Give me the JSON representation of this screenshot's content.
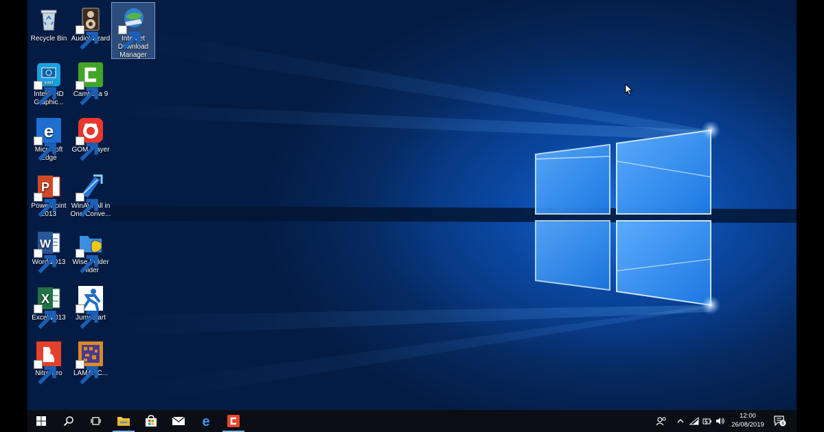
{
  "desktop": {
    "icons": [
      {
        "label": "Recycle Bin",
        "icon": "recycle-bin-icon"
      },
      {
        "label": "AudioWizard",
        "icon": "audiowizard-icon"
      },
      {
        "label": "Internet Download Manager",
        "icon": "internet-download-manager-icon"
      },
      {
        "label": "Intel® HD Graphic...",
        "icon": "intel-hd-graphics-icon"
      },
      {
        "label": "Camtasia 9",
        "icon": "camtasia-icon"
      },
      {
        "label": "Microsoft Edge",
        "icon": "edge-icon"
      },
      {
        "label": "GOM Player",
        "icon": "gom-player-icon"
      },
      {
        "label": "PowerPoint 2013",
        "icon": "powerpoint-icon"
      },
      {
        "label": "WinAVI All in One Conve...",
        "icon": "winavi-icon"
      },
      {
        "label": "Word 2013",
        "icon": "word-icon"
      },
      {
        "label": "Wise Folder Hider",
        "icon": "wise-folder-hider-icon"
      },
      {
        "label": "Excel 2013",
        "icon": "excel-icon"
      },
      {
        "label": "Jumpstart",
        "icon": "jumpstart-icon"
      },
      {
        "label": "Nitro Pro",
        "icon": "nitro-pro-icon"
      },
      {
        "label": "LAMANC...",
        "icon": "lamanc-icon"
      }
    ]
  },
  "taskbar": {
    "buttons": [
      "start-icon",
      "search-icon",
      "task-view-icon",
      "file-explorer-icon",
      "store-icon",
      "mail-icon",
      "edge-icon",
      "camtasia-icon"
    ],
    "tray": [
      "people-icon",
      "chevron-up-icon",
      "network-icon",
      "battery-icon",
      "volume-icon"
    ],
    "clock": {
      "time": "12:00",
      "date": "26/08/2019"
    },
    "notifications": {
      "count": "4"
    }
  },
  "colors": {
    "taskbar": "#0b0e15",
    "accent": "#7fb0e8",
    "wallpaper": "#0b4aa6"
  }
}
